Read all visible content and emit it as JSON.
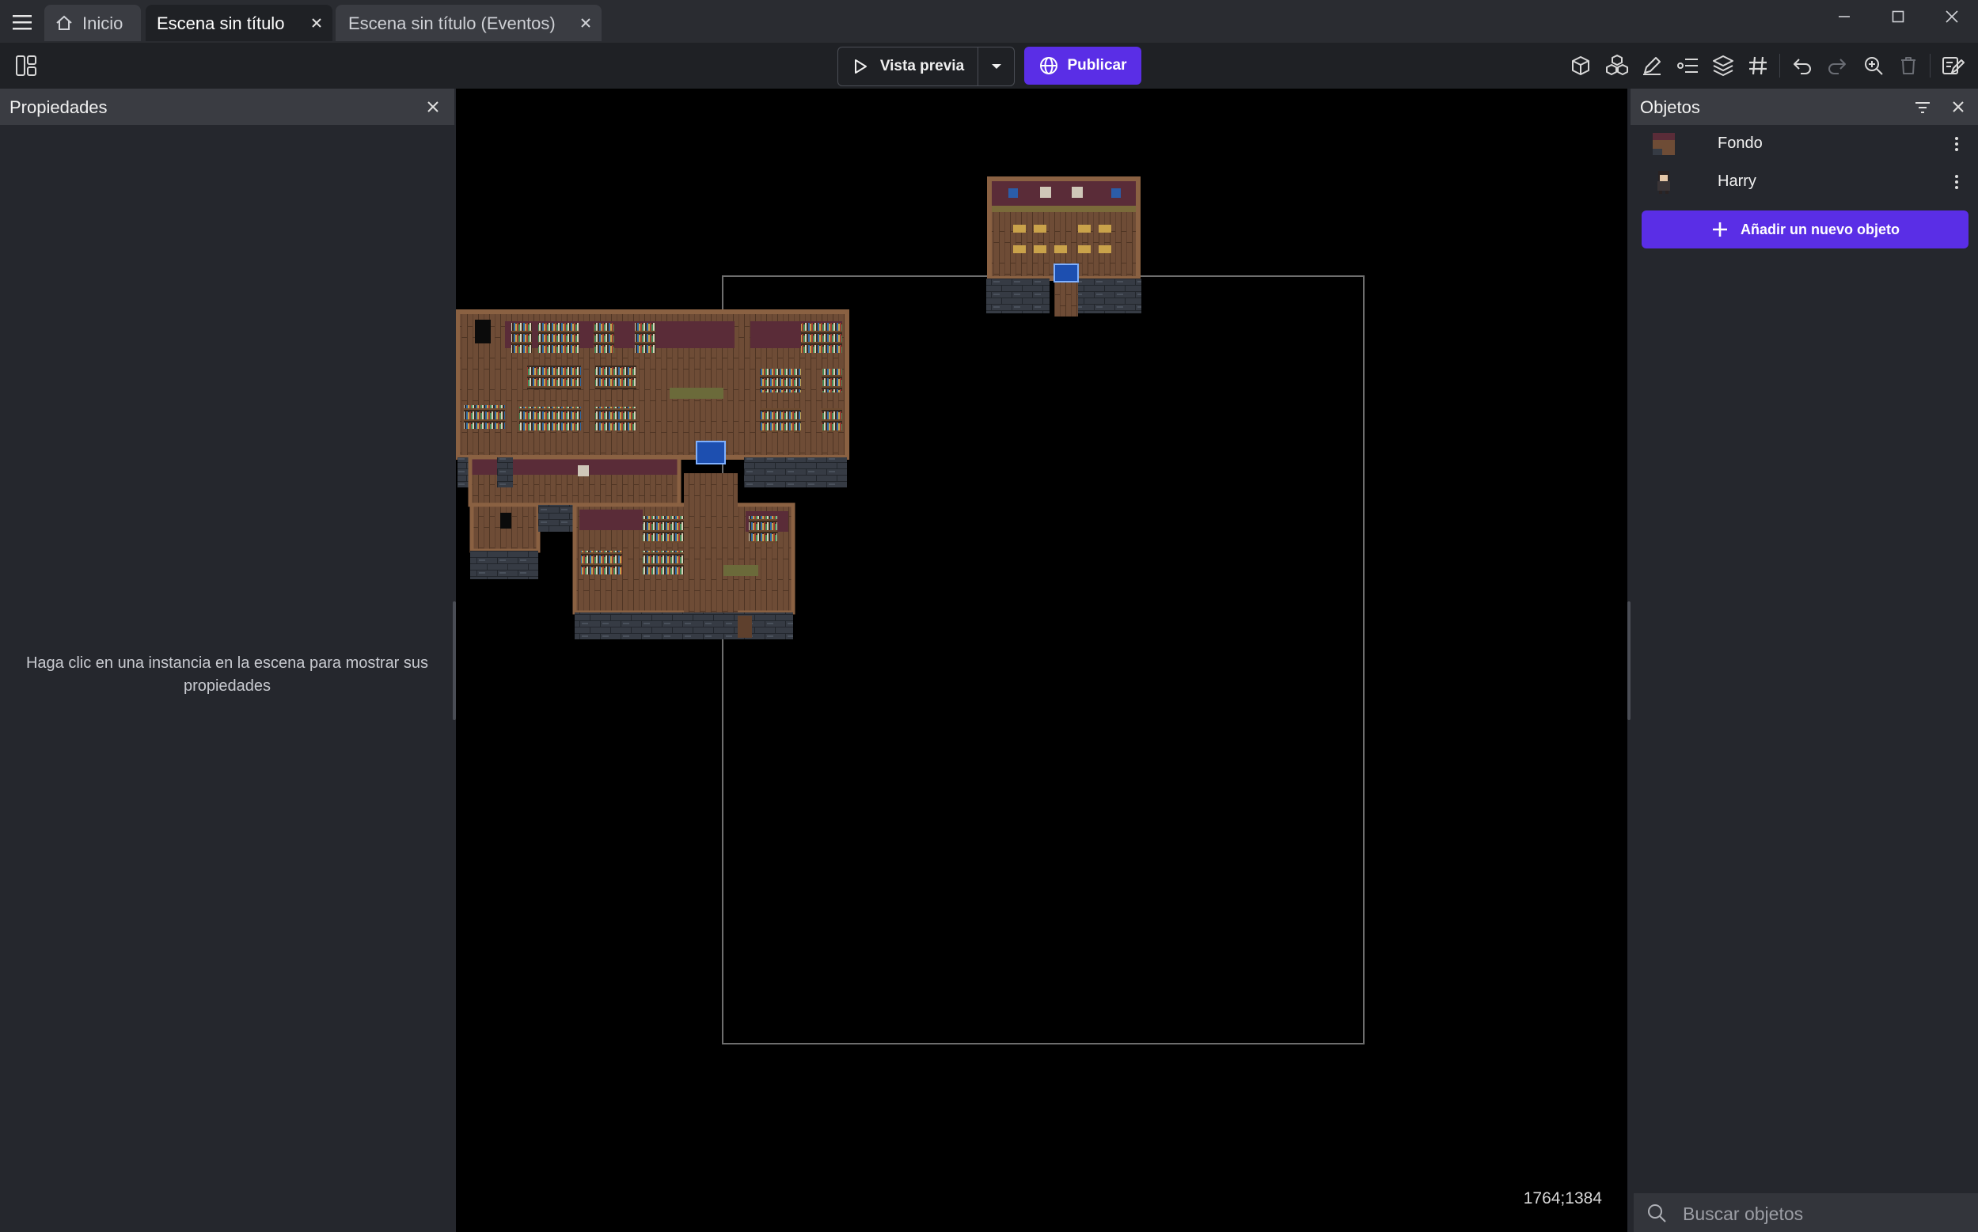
{
  "titlebar": {
    "tabs": [
      {
        "label": "Inicio",
        "icon": "home-icon"
      },
      {
        "label": "Escena sin título",
        "icon": "close-icon"
      },
      {
        "label": "Escena sin título (Eventos)",
        "icon": "close-icon"
      }
    ],
    "window_controls": [
      "minimize-icon",
      "maximize-icon",
      "close-icon"
    ]
  },
  "toolbar": {
    "preview_label": "Vista previa",
    "publish_label": "Publicar",
    "tools": [
      "object-icon",
      "object-groups-icon",
      "edit-icon",
      "properties-list-icon",
      "layers-icon",
      "grid-icon",
      "undo-icon",
      "redo-icon",
      "zoom-icon",
      "delete-icon",
      "edit-scene-icon"
    ]
  },
  "properties_panel": {
    "title": "Propiedades",
    "empty_message": "Haga clic en una instancia en la escena para mostrar sus propiedades"
  },
  "canvas": {
    "coordinates": "1764;1384"
  },
  "objects_panel": {
    "title": "Objetos",
    "objects": [
      {
        "name": "Fondo"
      },
      {
        "name": "Harry"
      }
    ],
    "add_button_label": "Añadir un nuevo objeto",
    "search_placeholder": "Buscar objetos"
  },
  "colors": {
    "accent": "#5a2ee6",
    "panel_bg": "#25272d",
    "header_bg": "#3a3c42",
    "canvas_bg": "#000000",
    "floor_wood": "#6e4c36",
    "wall_maroon": "#5a2c38",
    "stone": "#3a3f48"
  }
}
